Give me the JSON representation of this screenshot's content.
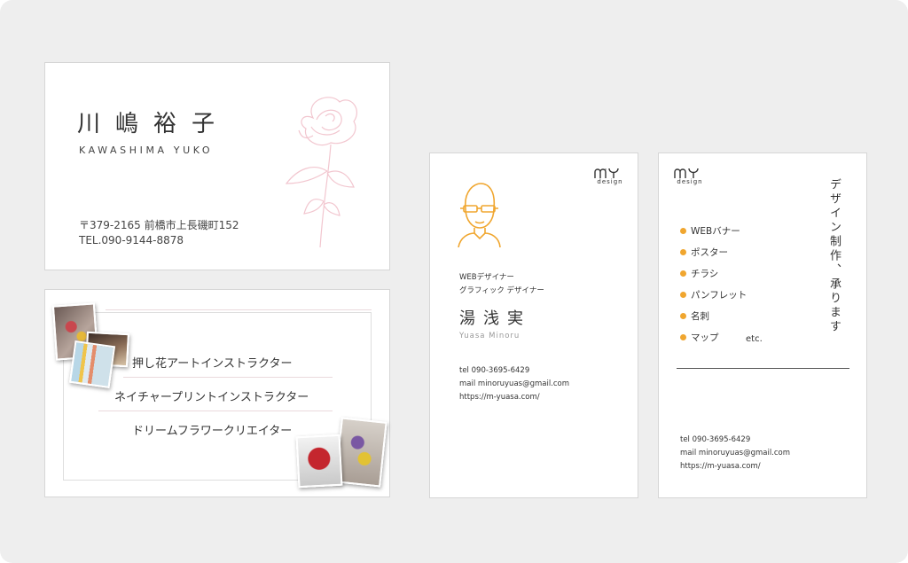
{
  "colors": {
    "background": "#eeeeee",
    "card": "#ffffff",
    "accent_orange": "#f0a62f",
    "rose_pink": "#f2c6cf"
  },
  "card_kawashima": {
    "name": "川嶋裕子",
    "name_roman": "KAWASHIMA YUKO",
    "address": "〒379-2165 前橋市上長磯町152",
    "tel": "TEL.090-9144-8878",
    "illustration": "rose"
  },
  "card_flowers": {
    "titles": [
      "押し花アートインストラクター",
      "ネイチャープリントインストラクター",
      "ドリームフラワークリエイター"
    ]
  },
  "card_yuasa_front": {
    "logo": "MY",
    "logo_sub": "design",
    "job_titles": [
      "WEBデザイナー",
      "グラフィック デザイナー"
    ],
    "name": "湯浅実",
    "name_roman": "Yuasa Minoru",
    "tel": "tel 090-3695-6429",
    "mail": "mail minoruyuas@gmail.com",
    "url": "https://m-yuasa.com/"
  },
  "card_yuasa_back": {
    "logo": "MY",
    "logo_sub": "design",
    "services": [
      "WEBバナー",
      "ポスター",
      "チラシ",
      "パンフレット",
      "名刺",
      "マップ"
    ],
    "etc": "etc.",
    "tagline": "デザイン制作、承ります",
    "tel": "tel 090-3695-6429",
    "mail": "mail minoruyuas@gmail.com",
    "url": "https://m-yuasa.com/"
  }
}
